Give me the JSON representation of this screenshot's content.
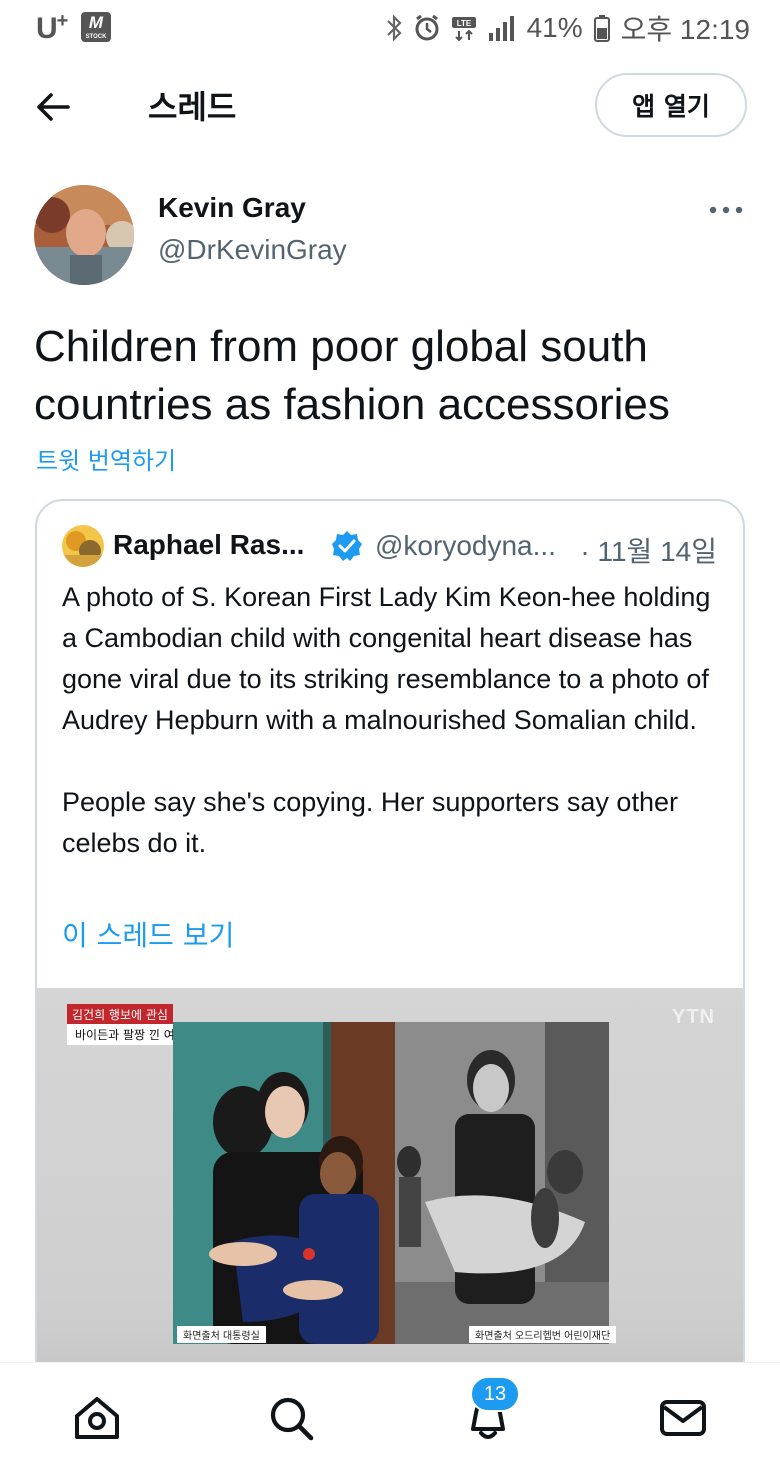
{
  "status_bar": {
    "carrier": "U",
    "carrier_plus": "+",
    "carrier_app": "M",
    "carrier_app_sub": "STOCK",
    "battery": "41%",
    "time": "오후 12:19",
    "icons": [
      "bluetooth-icon",
      "alarm-icon",
      "lte-icon",
      "signal-icon",
      "battery-icon"
    ]
  },
  "header": {
    "title": "스레드",
    "open_app_label": "앱 열기"
  },
  "tweet": {
    "author_name": "Kevin Gray",
    "author_handle": "@DrKevinGray",
    "text": "Children from poor global south countries as fashion accessories",
    "translate_label": "트윗 번역하기"
  },
  "quote": {
    "author_name": "Raphael Ras...",
    "author_handle": "@koryodyna...",
    "date": "· 11월 14일",
    "paragraph1": "A photo of S. Korean First Lady Kim Keon-hee holding a Cambodian child with congenital heart disease has gone viral due to its striking resemblance to a photo of Audrey Hepburn with a malnourished Somalian child.",
    "paragraph2": "People say she's copying. Her supporters say other celebs do it.",
    "show_thread_label": "이 스레드 보기",
    "media": {
      "watermark": "YTN",
      "caption_red": "김건희 행보에 관심",
      "caption_white": "바이든과 팔짱 낀 여사",
      "source_left": "화면출처  대통령실",
      "source_right": "화면출처  오드리헵번 어린이재단"
    }
  },
  "bottom_nav": {
    "items": [
      "home-icon",
      "search-icon",
      "notifications-icon",
      "messages-icon"
    ],
    "notification_count": "13"
  },
  "colors": {
    "accent": "#1d9bf0",
    "text": "#0f1419",
    "secondary": "#536471",
    "border": "#cfd9de"
  }
}
